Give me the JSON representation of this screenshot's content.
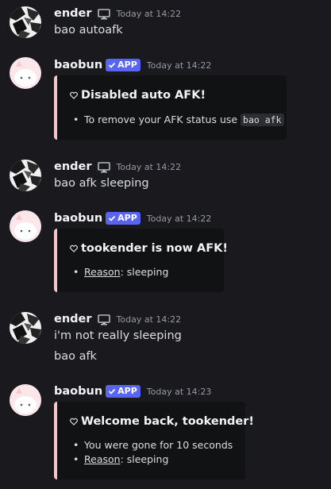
{
  "messages": [
    {
      "username": "ender",
      "timestamp": "Today at 14:22",
      "lines": [
        "bao autoafk"
      ]
    },
    {
      "username": "baobun",
      "badge": "APP",
      "timestamp": "Today at 14:22",
      "embed": {
        "title": "Disabled auto AFK!",
        "bullets": [
          {
            "text": "To remove your AFK status use ",
            "code": "bao afk"
          }
        ]
      }
    },
    {
      "username": "ender",
      "timestamp": "Today at 14:22",
      "lines": [
        "bao afk sleeping"
      ]
    },
    {
      "username": "baobun",
      "badge": "APP",
      "timestamp": "Today at 14:22",
      "embed": {
        "title": "tookender is now AFK!",
        "bullets": [
          {
            "label": "Reason",
            "value": ": sleeping"
          }
        ]
      }
    },
    {
      "username": "ender",
      "timestamp": "Today at 14:22",
      "lines": [
        "i'm not really sleeping",
        "bao afk"
      ]
    },
    {
      "username": "baobun",
      "badge": "APP",
      "timestamp": "Today at 14:23",
      "embed": {
        "title": "Welcome back, tookender!",
        "bullets": [
          {
            "text": "You were gone for 10 seconds"
          },
          {
            "label": "Reason",
            "value": ": sleeping"
          }
        ]
      }
    }
  ],
  "colors": {
    "background": "#1a1a1e",
    "app_badge": "#5865f2",
    "embed_border": "#f4c6cd",
    "embed_bg": "#111214"
  },
  "icons": {
    "desktop": "monitor-icon",
    "verified": "check-icon",
    "embed_title": "heart-icon"
  }
}
